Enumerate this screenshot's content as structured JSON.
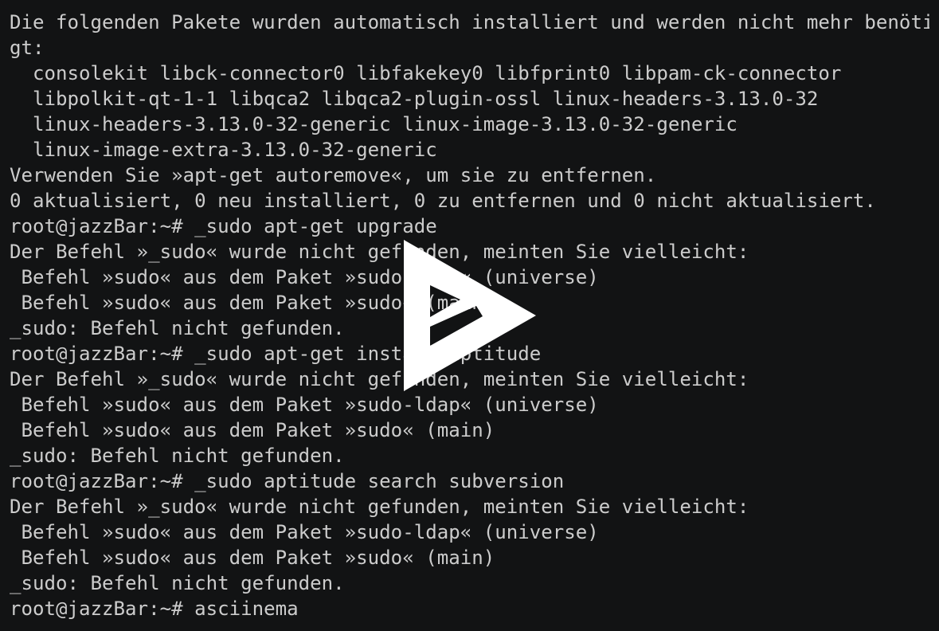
{
  "terminal": {
    "lines": [
      "Die folgenden Pakete wurden automatisch installiert und werden nicht mehr benöti",
      "gt:",
      "  consolekit libck-connector0 libfakekey0 libfprint0 libpam-ck-connector",
      "  libpolkit-qt-1-1 libqca2 libqca2-plugin-ossl linux-headers-3.13.0-32",
      "  linux-headers-3.13.0-32-generic linux-image-3.13.0-32-generic",
      "  linux-image-extra-3.13.0-32-generic",
      "Verwenden Sie »apt-get autoremove«, um sie zu entfernen.",
      "0 aktualisiert, 0 neu installiert, 0 zu entfernen und 0 nicht aktualisiert.",
      "root@jazzBar:~# _sudo apt-get upgrade",
      "Der Befehl »_sudo« wurde nicht gefunden, meinten Sie vielleicht:",
      " Befehl »sudo« aus dem Paket »sudo-ldap« (universe)",
      " Befehl »sudo« aus dem Paket »sudo« (main)",
      "_sudo: Befehl nicht gefunden.",
      "root@jazzBar:~# _sudo apt-get install aptitude",
      "Der Befehl »_sudo« wurde nicht gefunden, meinten Sie vielleicht:",
      " Befehl »sudo« aus dem Paket »sudo-ldap« (universe)",
      " Befehl »sudo« aus dem Paket »sudo« (main)",
      "_sudo: Befehl nicht gefunden.",
      "root@jazzBar:~# _sudo aptitude search subversion",
      "Der Befehl »_sudo« wurde nicht gefunden, meinten Sie vielleicht:",
      " Befehl »sudo« aus dem Paket »sudo-ldap« (universe)",
      " Befehl »sudo« aus dem Paket »sudo« (main)",
      "_sudo: Befehl nicht gefunden.",
      "root@jazzBar:~# asciinema"
    ]
  },
  "overlay": {
    "icon": "asciinema-play-icon",
    "color": "#ffffff"
  },
  "colors": {
    "background": "#121314",
    "foreground": "#cccccc"
  }
}
